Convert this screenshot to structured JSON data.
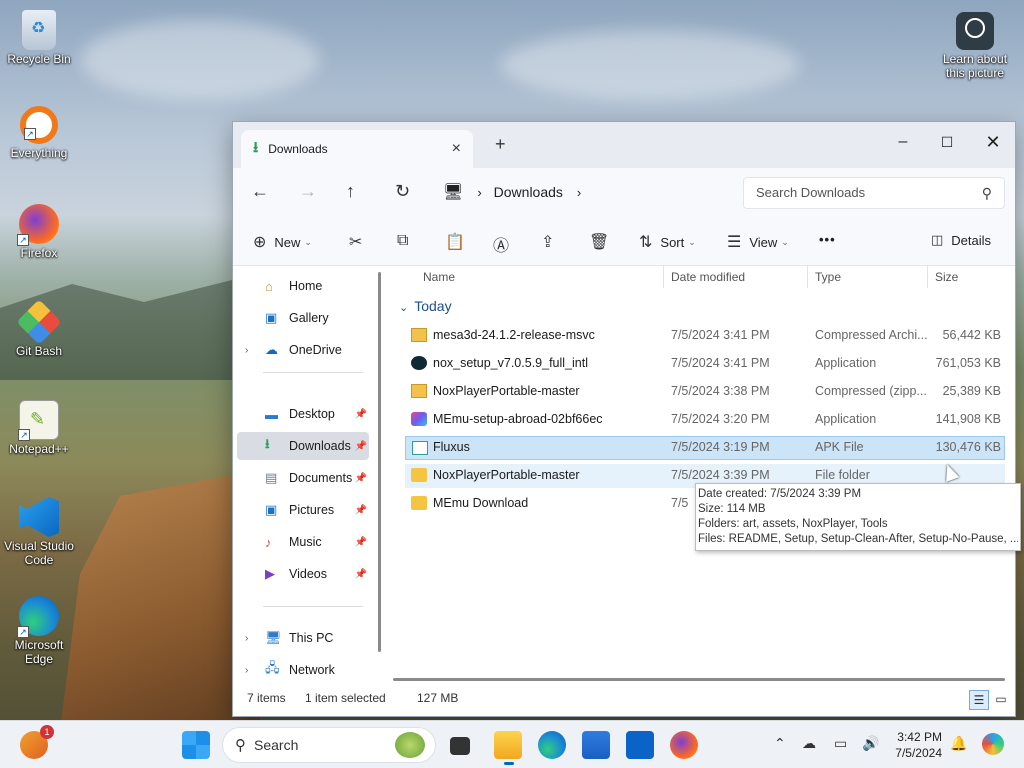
{
  "desktop": {
    "icons": [
      {
        "label": "Recycle Bin"
      },
      {
        "label": "Everything"
      },
      {
        "label": "Firefox"
      },
      {
        "label": "Git Bash"
      },
      {
        "label": "Notepad++"
      },
      {
        "label": "Visual Studio Code"
      },
      {
        "label": "Microsoft Edge"
      }
    ],
    "learn_picture": "Learn about this picture"
  },
  "window": {
    "tab_title": "Downloads",
    "breadcrumb": {
      "current": "Downloads"
    },
    "search_placeholder": "Search Downloads",
    "toolbar": {
      "new": "New",
      "sort": "Sort",
      "view": "View",
      "more": "•••",
      "details": "Details"
    },
    "sidebar": {
      "home": "Home",
      "gallery": "Gallery",
      "onedrive": "OneDrive",
      "desktop": "Desktop",
      "downloads": "Downloads",
      "documents": "Documents",
      "pictures": "Pictures",
      "music": "Music",
      "videos": "Videos",
      "thispc": "This PC",
      "network": "Network"
    },
    "columns": {
      "name": "Name",
      "date": "Date modified",
      "type": "Type",
      "size": "Size"
    },
    "group": "Today",
    "files": [
      {
        "name": "mesa3d-24.1.2-release-msvc",
        "date": "7/5/2024 3:41 PM",
        "type": "Compressed Archi...",
        "size": "56,442 KB"
      },
      {
        "name": "nox_setup_v7.0.5.9_full_intl",
        "date": "7/5/2024 3:41 PM",
        "type": "Application",
        "size": "761,053 KB"
      },
      {
        "name": "NoxPlayerPortable-master",
        "date": "7/5/2024 3:38 PM",
        "type": "Compressed (zipp...",
        "size": "25,389 KB"
      },
      {
        "name": "MEmu-setup-abroad-02bf66ec",
        "date": "7/5/2024 3:20 PM",
        "type": "Application",
        "size": "141,908 KB"
      },
      {
        "name": "Fluxus",
        "date": "7/5/2024 3:19 PM",
        "type": "APK File",
        "size": "130,476 KB"
      },
      {
        "name": "NoxPlayerPortable-master",
        "date": "7/5/2024 3:39 PM",
        "type": "File folder",
        "size": ""
      },
      {
        "name": "MEmu Download",
        "date": "7/5",
        "type": "",
        "size": ""
      }
    ],
    "tooltip": {
      "created": "Date created: 7/5/2024 3:39 PM",
      "size": "Size: 114 MB",
      "folders": "Folders: art, assets, NoxPlayer, Tools",
      "files": "Files: README, Setup, Setup-Clean-After, Setup-No-Pause, ..."
    },
    "status": {
      "items": "7 items",
      "selected": "1 item selected",
      "size": "127 MB"
    }
  },
  "taskbar": {
    "search": "Search",
    "badge": "1",
    "time": "3:42 PM",
    "date": "7/5/2024"
  },
  "colors": {
    "accent": "#0067c0",
    "selection": "#cce4f7",
    "folder": "#f5c542"
  }
}
